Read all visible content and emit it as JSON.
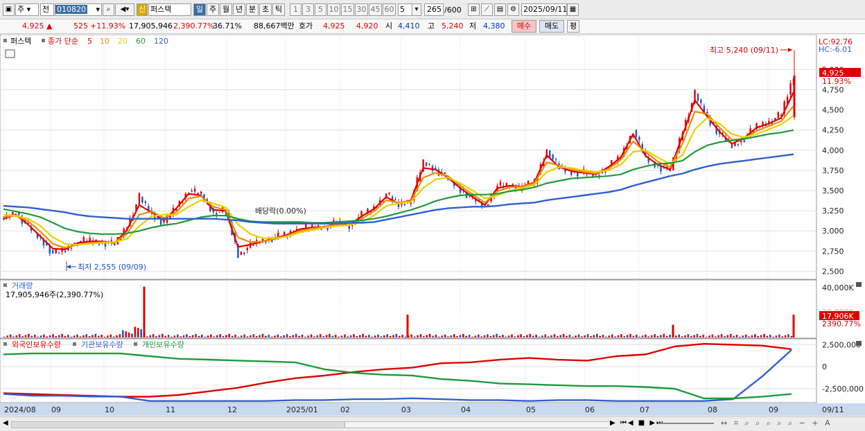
{
  "toolbar": {
    "market": "주",
    "mode": "전",
    "code": "010820",
    "name_badge": "신",
    "name": "퍼스텍",
    "periods": [
      "일",
      "주",
      "월",
      "년",
      "분",
      "초",
      "틱"
    ],
    "active_period": "일",
    "intervals": [
      "1",
      "3",
      "5",
      "10",
      "15",
      "30",
      "45",
      "60"
    ],
    "interval_value": "5",
    "count": "265",
    "count_max": "/600",
    "date": "2025/09/11"
  },
  "quote": {
    "price": "4,925",
    "change": "525",
    "change_pct": "+11.93%",
    "volume": "17,905,946",
    "volume_ratio": "2,390.77%",
    "turnover": "36.71%",
    "amount": "88,667백만",
    "bid_label": "호가",
    "bid1": "4,925",
    "bid2": "4,920",
    "open_label": "시",
    "open": "4,410",
    "high_label": "고",
    "high": "5,240",
    "low_label": "저",
    "low": "4,380",
    "buy": "매수",
    "sell": "매도",
    "eval": "평"
  },
  "legend": {
    "name": "퍼스텍",
    "close": "종가 단순",
    "ma": [
      {
        "label": "5",
        "color": "#e00000"
      },
      {
        "label": "10",
        "color": "#f08c00"
      },
      {
        "label": "20",
        "color": "#e6d200"
      },
      {
        "label": "60",
        "color": "#1e9a3c"
      },
      {
        "label": "120",
        "color": "#2f5fd0"
      }
    ]
  },
  "price_panel": {
    "lc": "LC:92.76",
    "hc": "HC:-6.01",
    "yticks": [
      "5,000",
      "4,750",
      "4,500",
      "4,250",
      "4,000",
      "3,750",
      "3,500",
      "3,250",
      "3,000",
      "2,750",
      "2,500"
    ],
    "ymin": 2400,
    "ymax": 5330,
    "last_price": "4,925",
    "last_pct": "11.93%",
    "high_note": "최고 5,240 (09/11)",
    "low_note": "최저 2,555 (09/09)",
    "dividend_note": "배당락(0.00%)"
  },
  "volume_panel": {
    "title": "거래량",
    "info": "17,905,946주(2,390.77%)",
    "yticks": [
      "40,000K"
    ],
    "last_value": "17,906K",
    "last_pct": "2390.77%",
    "ghost_label": "20,000K"
  },
  "holding_panel": {
    "labels": [
      {
        "text": "외국인보유수량",
        "color": "#e00000"
      },
      {
        "text": "기관보유수량",
        "color": "#2f5fd0"
      },
      {
        "text": "개인보유수량",
        "color": "#1e9a3c"
      }
    ],
    "yticks": [
      "2,500,000",
      "0",
      "-2,500,000"
    ]
  },
  "x_axis": {
    "labels": [
      "2024/08",
      "09",
      "10",
      "11",
      "12",
      "2025/01",
      "02",
      "03",
      "04",
      "05",
      "06",
      "07",
      "08",
      "09"
    ],
    "current": "09/11"
  },
  "chart_data": {
    "type": "candlestick",
    "title": "퍼스텍",
    "period": "daily",
    "range_start": "2024/08",
    "range_end": "2025/09/11",
    "bars": 265,
    "month_starts": [
      "2024/08",
      "09",
      "10",
      "11",
      "12",
      "2025/01",
      "02",
      "03",
      "04",
      "05",
      "06",
      "07",
      "08",
      "09"
    ],
    "close_path": [
      3150,
      3230,
      3050,
      2900,
      2720,
      2760,
      2870,
      2880,
      2860,
      2830,
      3060,
      3420,
      3200,
      3100,
      3300,
      3500,
      3450,
      3220,
      3250,
      2700,
      2820,
      2880,
      2920,
      2960,
      3030,
      3040,
      3050,
      3100,
      3060,
      3200,
      3280,
      3460,
      3320,
      3380,
      3850,
      3760,
      3650,
      3510,
      3400,
      3300,
      3560,
      3560,
      3550,
      3600,
      4000,
      3780,
      3730,
      3720,
      3690,
      3800,
      3920,
      4250,
      3900,
      3800,
      3750,
      4250,
      4700,
      4400,
      4200,
      4050,
      4150,
      4300,
      4350,
      4450,
      4925
    ],
    "ma_series": [
      {
        "name": "5",
        "values": [
          3150,
          3200,
          3080,
          2930,
          2780,
          2770,
          2850,
          2870,
          2870,
          2850,
          3010,
          3320,
          3230,
          3130,
          3280,
          3460,
          3440,
          3260,
          3250,
          2800,
          2830,
          2870,
          2910,
          2950,
          3020,
          3040,
          3050,
          3090,
          3070,
          3180,
          3270,
          3420,
          3340,
          3380,
          3780,
          3760,
          3660,
          3530,
          3420,
          3320,
          3530,
          3560,
          3550,
          3600,
          3940,
          3790,
          3740,
          3720,
          3700,
          3790,
          3910,
          4200,
          3930,
          3820,
          3760,
          4180,
          4620,
          4420,
          4230,
          4080,
          4150,
          4280,
          4330,
          4400,
          4720
        ]
      },
      {
        "name": "10",
        "values": [
          3170,
          3190,
          3120,
          2990,
          2840,
          2790,
          2830,
          2850,
          2860,
          2860,
          2960,
          3200,
          3240,
          3160,
          3230,
          3400,
          3430,
          3300,
          3260,
          2920,
          2860,
          2870,
          2900,
          2940,
          3000,
          3030,
          3050,
          3080,
          3070,
          3150,
          3240,
          3380,
          3350,
          3370,
          3660,
          3720,
          3680,
          3560,
          3450,
          3350,
          3490,
          3540,
          3550,
          3590,
          3850,
          3810,
          3760,
          3730,
          3710,
          3770,
          3880,
          4110,
          3980,
          3860,
          3790,
          4080,
          4480,
          4450,
          4280,
          4130,
          4140,
          4240,
          4300,
          4360,
          4550
        ]
      },
      {
        "name": "20",
        "values": [
          3200,
          3190,
          3150,
          3060,
          2920,
          2840,
          2830,
          2840,
          2850,
          2860,
          2900,
          3060,
          3180,
          3200,
          3200,
          3300,
          3380,
          3340,
          3290,
          3080,
          2960,
          2910,
          2910,
          2930,
          2980,
          3010,
          3040,
          3060,
          3070,
          3110,
          3190,
          3310,
          3340,
          3360,
          3530,
          3640,
          3660,
          3590,
          3500,
          3400,
          3440,
          3500,
          3530,
          3570,
          3730,
          3790,
          3780,
          3750,
          3730,
          3750,
          3820,
          3980,
          4000,
          3910,
          3830,
          3940,
          4260,
          4400,
          4330,
          4200,
          4160,
          4200,
          4260,
          4320,
          4430
        ]
      },
      {
        "name": "60",
        "values": [
          3270,
          3240,
          3210,
          3170,
          3100,
          3030,
          2990,
          2970,
          2960,
          2960,
          2970,
          3000,
          3040,
          3070,
          3090,
          3130,
          3170,
          3190,
          3190,
          3150,
          3120,
          3110,
          3110,
          3110,
          3110,
          3100,
          3100,
          3110,
          3120,
          3130,
          3150,
          3180,
          3220,
          3260,
          3310,
          3370,
          3410,
          3440,
          3450,
          3450,
          3460,
          3490,
          3510,
          3540,
          3590,
          3620,
          3650,
          3660,
          3670,
          3680,
          3700,
          3760,
          3800,
          3830,
          3840,
          3870,
          3980,
          4060,
          4100,
          4120,
          4140,
          4170,
          4200,
          4220,
          4250
        ]
      },
      {
        "name": "120",
        "values": [
          3310,
          3300,
          3290,
          3270,
          3250,
          3230,
          3200,
          3180,
          3170,
          3160,
          3150,
          3150,
          3150,
          3150,
          3150,
          3150,
          3150,
          3150,
          3140,
          3130,
          3110,
          3100,
          3090,
          3090,
          3090,
          3090,
          3090,
          3090,
          3100,
          3100,
          3110,
          3140,
          3170,
          3200,
          3230,
          3260,
          3280,
          3290,
          3300,
          3300,
          3310,
          3330,
          3340,
          3350,
          3380,
          3400,
          3420,
          3440,
          3460,
          3480,
          3510,
          3560,
          3600,
          3640,
          3680,
          3710,
          3760,
          3800,
          3830,
          3850,
          3870,
          3890,
          3910,
          3930,
          3950
        ]
      }
    ],
    "volume_spikes_k": [
      {
        "month": "10",
        "value": 40000
      },
      {
        "month": "03",
        "value": 18000
      },
      {
        "month": "07",
        "value": 10000
      },
      {
        "month": "09/11",
        "value": 17906
      }
    ],
    "holdings": [
      {
        "name": "외국인보유수량",
        "values": [
          -3200000,
          -3300000,
          -3400000,
          -3500000,
          -3600000,
          -3600000,
          -3400000,
          -3000000,
          -2600000,
          -2000000,
          -1500000,
          -1200000,
          -800000,
          -500000,
          -300000,
          200000,
          300000,
          600000,
          800000,
          600000,
          500000,
          1000000,
          1200000,
          2100000,
          2400000,
          2300000,
          2200000,
          1800000
        ]
      },
      {
        "name": "기관보유수량",
        "values": [
          -3000000,
          -3200000,
          -3200000,
          -3300000,
          -3300000,
          -3800000,
          -3800000,
          -3800000,
          -3800000,
          -3800000,
          -3700000,
          -3700000,
          -3600000,
          -3600000,
          -3500000,
          -3600000,
          -3700000,
          -3700000,
          -3800000,
          -3700000,
          -3700000,
          -3800000,
          -3800000,
          -3800000,
          -3800000,
          -3600000,
          -1000000,
          2000000
        ]
      },
      {
        "name": "개인보유수량",
        "values": [
          1300000,
          1400000,
          1400000,
          1400000,
          1400000,
          1100000,
          800000,
          700000,
          600000,
          500000,
          400000,
          -400000,
          -800000,
          -1000000,
          -1100000,
          -1500000,
          -1700000,
          -2000000,
          -2100000,
          -2200000,
          -2300000,
          -2300000,
          -2400000,
          -2600000,
          -3700000,
          -3700000,
          -3500000,
          -3200000
        ]
      }
    ],
    "ylim": [
      2400,
      5330
    ]
  }
}
